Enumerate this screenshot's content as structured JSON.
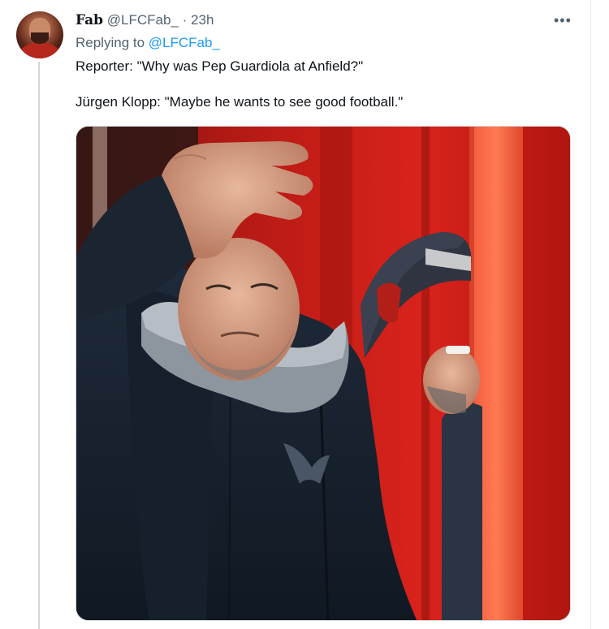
{
  "tweet": {
    "author": {
      "display_name": "Fab",
      "handle": "@LFCFab_",
      "separator": "·",
      "time": "23h"
    },
    "replying": {
      "prefix": "Replying to ",
      "mention": "@LFCFab_"
    },
    "text_lines": [
      "Reporter: \"Why was Pep Guardiola at Anfield?\"",
      "Jürgen Klopp: \"Maybe he wants to see good football.\""
    ],
    "more_glyph": "•••",
    "icons": {
      "more": "more-horizontal-icon",
      "avatar": "profile-avatar"
    },
    "media": {
      "kind": "photo"
    }
  },
  "colors": {
    "text_primary": "#0f1419",
    "text_secondary": "#536471",
    "link": "#1d9bf0",
    "thread_line": "#cfd9de",
    "photo_red": "#c31a14"
  }
}
